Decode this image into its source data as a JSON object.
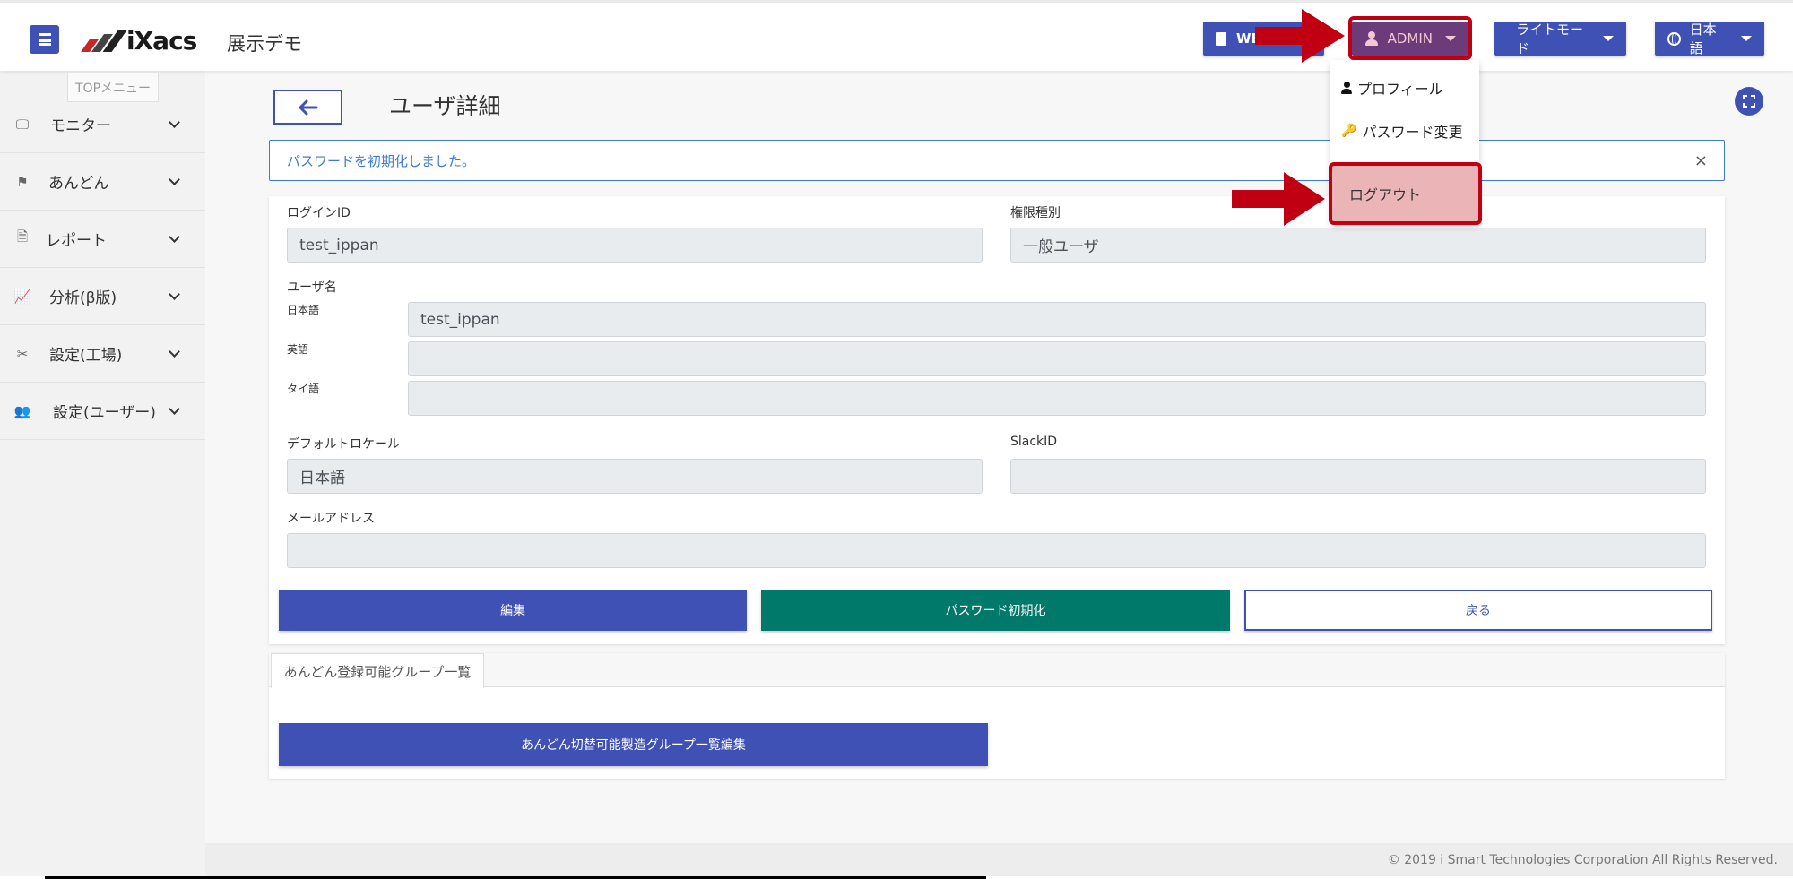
{
  "header": {
    "logo_text": "iXacs",
    "site_name": "展示デモ",
    "web_button_label": "WE",
    "admin_label": "ADMIN",
    "mode_label": "ライトモード",
    "language_label": "日本語"
  },
  "user_menu": {
    "profile_label": "プロフィール",
    "password_change_label": "パスワード変更",
    "logout_label": "ログアウト"
  },
  "sidebar": {
    "tooltip": "TOPメニュー",
    "items": [
      {
        "label": "モニター",
        "icon": "monitor-icon"
      },
      {
        "label": "あんどん",
        "icon": "andon-flag-icon"
      },
      {
        "label": "レポート",
        "icon": "report-file-icon"
      },
      {
        "label": "分析(β版)",
        "icon": "chart-line-icon"
      },
      {
        "label": "設定(工場)",
        "icon": "tools-icon"
      },
      {
        "label": "設定(ユーザー)",
        "icon": "users-cog-icon"
      }
    ]
  },
  "page": {
    "title": "ユーザ詳細",
    "back_icon": "arrow-left-icon",
    "expand_icon": "expand-icon"
  },
  "alert": {
    "message": "パスワードを初期化しました。",
    "close_glyph": "×"
  },
  "form": {
    "login_id_label": "ログインID",
    "login_id_value": "test_ippan",
    "role_label": "権限種別",
    "role_value": "一般ユーザ",
    "username_label": "ユーザ名",
    "name_ja_label": "日本語",
    "name_ja_value": "test_ippan",
    "name_en_label": "英語",
    "name_en_value": "",
    "name_th_label": "タイ語",
    "name_th_value": "",
    "locale_label": "デフォルトロケール",
    "locale_value": "日本語",
    "slack_label": "SlackID",
    "slack_value": "",
    "email_label": "メールアドレス",
    "email_value": ""
  },
  "actions": {
    "edit_label": "編集",
    "reset_password_label": "パスワード初期化",
    "back_label": "戻る"
  },
  "groups": {
    "tab_label": "あんどん登録可能グループ一覧",
    "edit_button_label": "あんどん切替可能製造グループ一覧編集"
  },
  "footer": {
    "copyright": "© 2019 i Smart Technologies Corporation All Rights Reserved."
  },
  "colors": {
    "primary": "#3f51b5",
    "teal": "#00796b",
    "highlight_red": "#c00012",
    "logout_highlight": "#ebb5b8",
    "admin_bg": "#6b3b7a"
  }
}
